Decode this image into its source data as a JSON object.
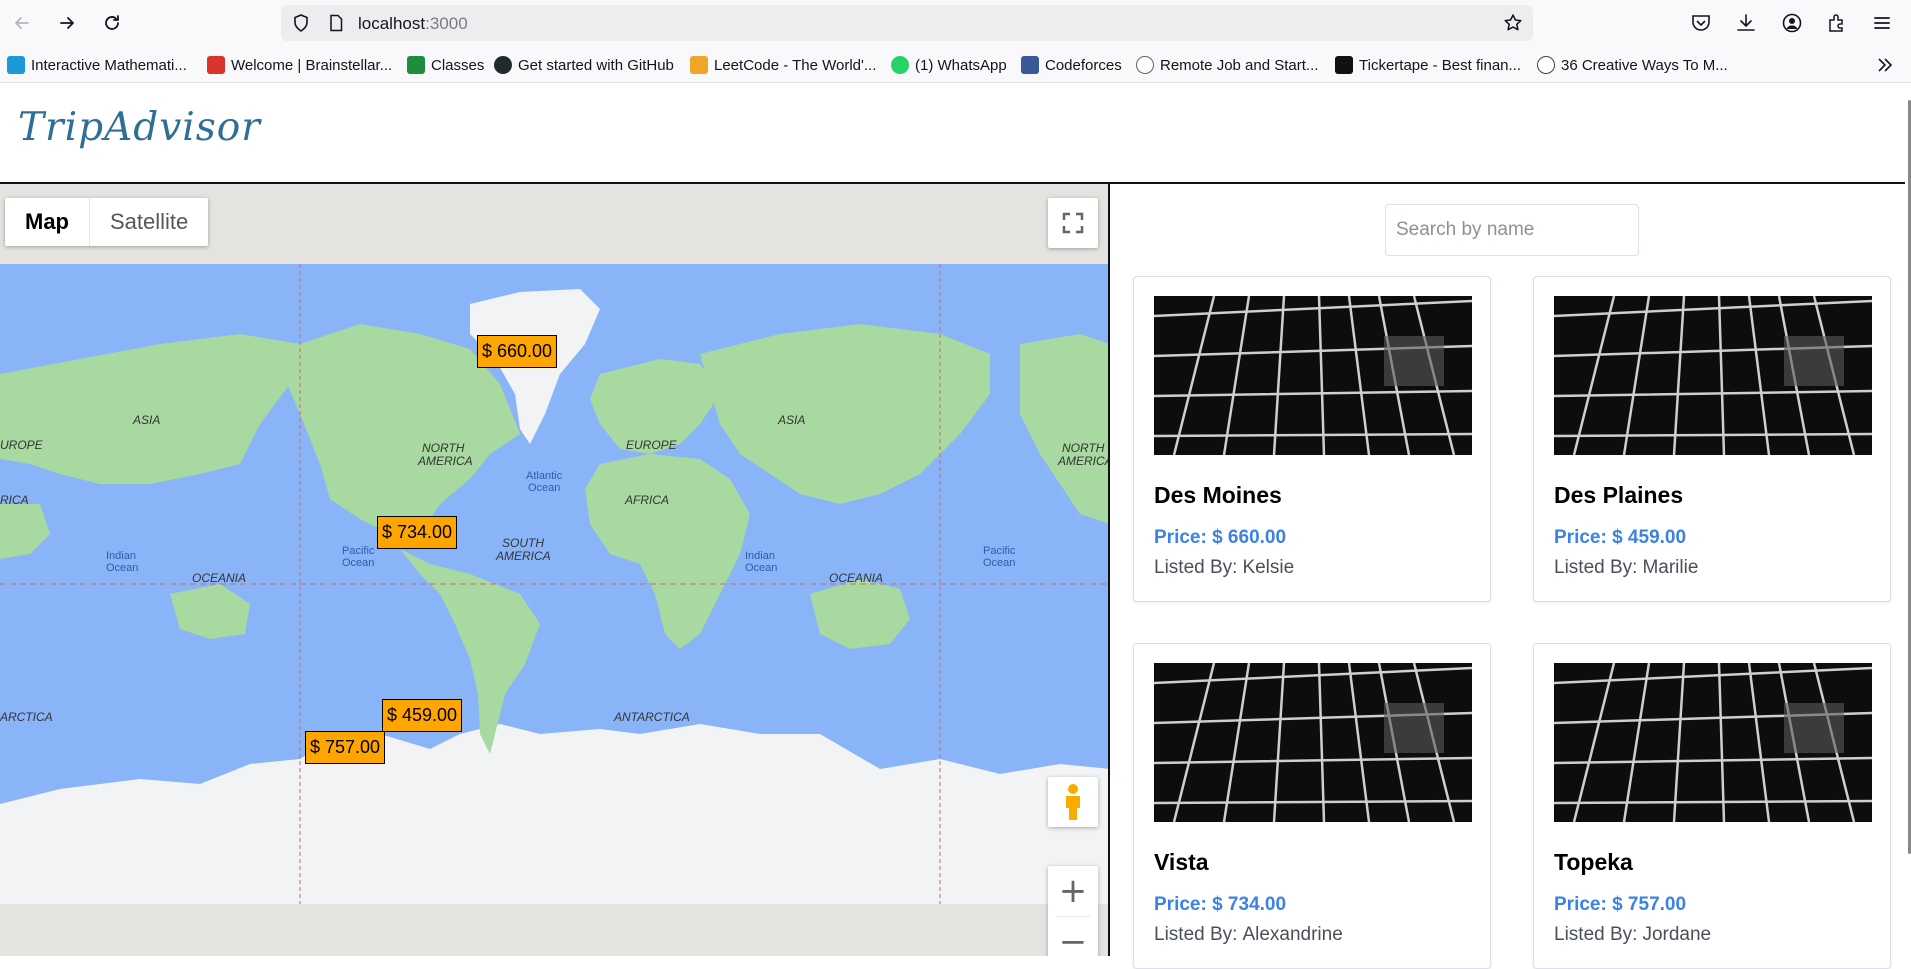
{
  "browser": {
    "url_host": "localhost",
    "url_path": ":3000",
    "bookmarks": [
      {
        "label": "Interactive Mathemati...",
        "color": "#1a9bd7"
      },
      {
        "label": "Welcome | Brainstellar...",
        "color": "#d9342b"
      },
      {
        "label": "Classes",
        "color": "#1e8e3e"
      },
      {
        "label": "Get started with GitHub",
        "color": "#24292e"
      },
      {
        "label": "LeetCode - The World'...",
        "color": "#f0a428"
      },
      {
        "label": "(1) WhatsApp",
        "color": "#25d366"
      },
      {
        "label": "Codeforces",
        "color": "#3b5998"
      },
      {
        "label": "Remote Job and Start...",
        "color": "#5f6368"
      },
      {
        "label": "Tickertape - Best finan...",
        "color": "#111111"
      },
      {
        "label": "36 Creative Ways To M...",
        "color": "#444444"
      }
    ]
  },
  "app": {
    "logo": "TripAdvisor"
  },
  "map": {
    "type_options": [
      "Map",
      "Satellite"
    ],
    "active_type": "Map",
    "ocean_color": "#8ab4f8",
    "land_color": "#a8d9a0",
    "labels": {
      "asia": "ASIA",
      "europe": "EUROPE",
      "europe_cut": "UROPE",
      "africa": "AFRICA",
      "africa_cut": "RICA",
      "north": "NORTH",
      "america": "AMERICA",
      "south": "SOUTH",
      "oceania": "OCEANIA",
      "antarctica": "ANTARCTICA",
      "antarctica_cut": "ARCTICA",
      "atlantic": "Atlantic",
      "indian": "Indian",
      "pacific": "Pacific",
      "ocean": "Ocean"
    },
    "markers": [
      {
        "label": "$ 660.00"
      },
      {
        "label": "$ 734.00"
      },
      {
        "label": "$ 459.00"
      },
      {
        "label": "$ 757.00"
      }
    ],
    "zoom_in": "+",
    "zoom_out": "−"
  },
  "panel": {
    "search_placeholder": "Search by name",
    "listed_by_label": "Listed By:",
    "listings": [
      {
        "title": "Des Moines",
        "price": "Price: $ 660.00",
        "owner": "Kelsie"
      },
      {
        "title": "Des Plaines",
        "price": "Price: $ 459.00",
        "owner": "Marilie"
      },
      {
        "title": "Vista",
        "price": "Price: $ 734.00",
        "owner": "Alexandrine"
      },
      {
        "title": "Topeka",
        "price": "Price: $ 757.00",
        "owner": "Jordane"
      }
    ]
  }
}
